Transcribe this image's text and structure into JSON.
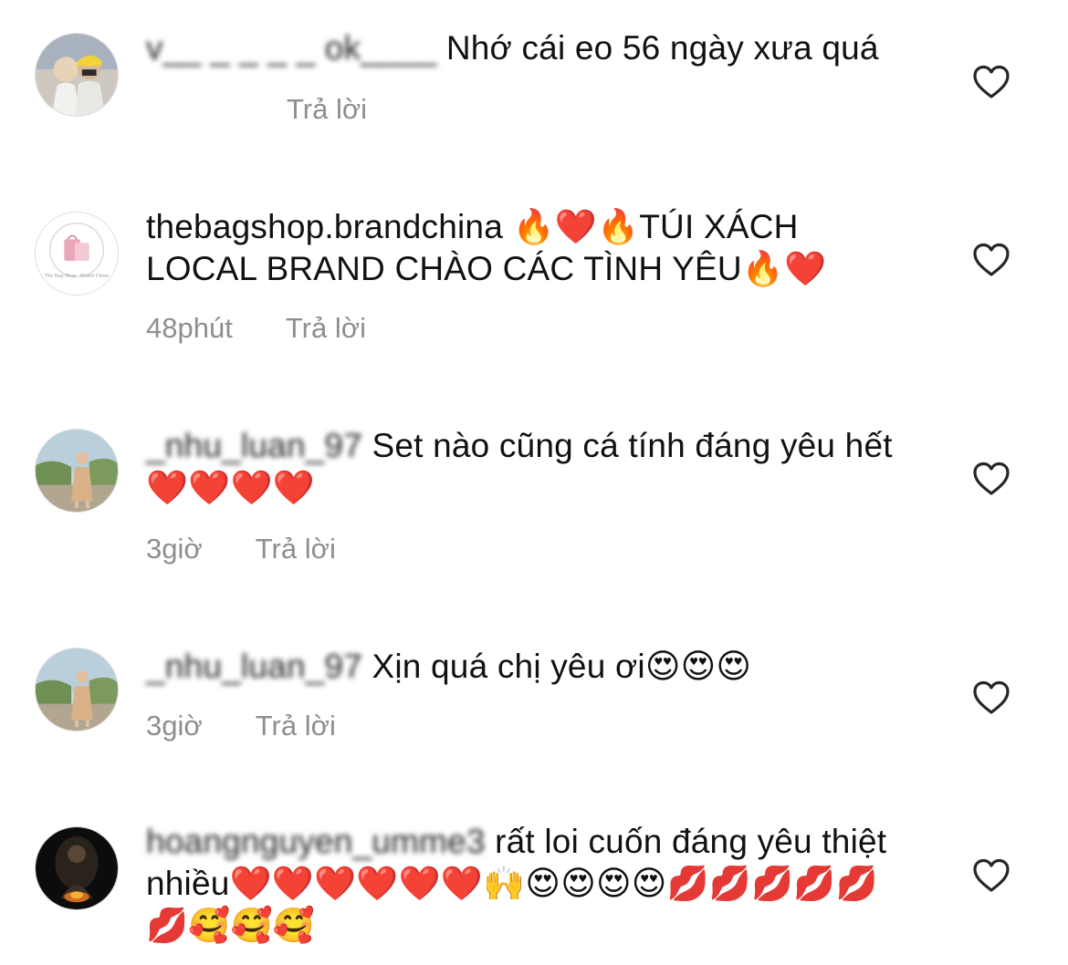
{
  "comments": [
    {
      "username": "v__ _ _ _ _ ok____",
      "text": "Nhớ cái eo 56 ngày xưa quá",
      "time": "",
      "reply_label": "Trả lời"
    },
    {
      "username": "thebagshop.brandchina",
      "text": "🔥❤️🔥TÚI XÁCH LOCAL BRAND CHÀO CÁC TÌNH YÊU🔥❤️",
      "time": "48phút",
      "reply_label": "Trả lời"
    },
    {
      "username": "_nhu_luan_97",
      "text": "Set nào cũng cá tính đáng yêu hết❤️❤️❤️❤️",
      "time": "3giờ",
      "reply_label": "Trả lời"
    },
    {
      "username": "_nhu_luan_97",
      "text": "Xịn quá chị yêu ơi😍😍😍",
      "time": "3giờ",
      "reply_label": "Trả lời"
    },
    {
      "username": "hoangnguyen_umme3",
      "text": "rất loi cuốn đáng yêu thiệt nhiều❤️❤️❤️❤️❤️❤️🙌😍😍😍😍💋💋💋💋💋💋🥰🥰🥰",
      "time": "",
      "reply_label": ""
    }
  ],
  "icons": {
    "like": "heart-outline-icon"
  },
  "colors": {
    "meta": "#8e8e8e",
    "text": "#111111"
  }
}
